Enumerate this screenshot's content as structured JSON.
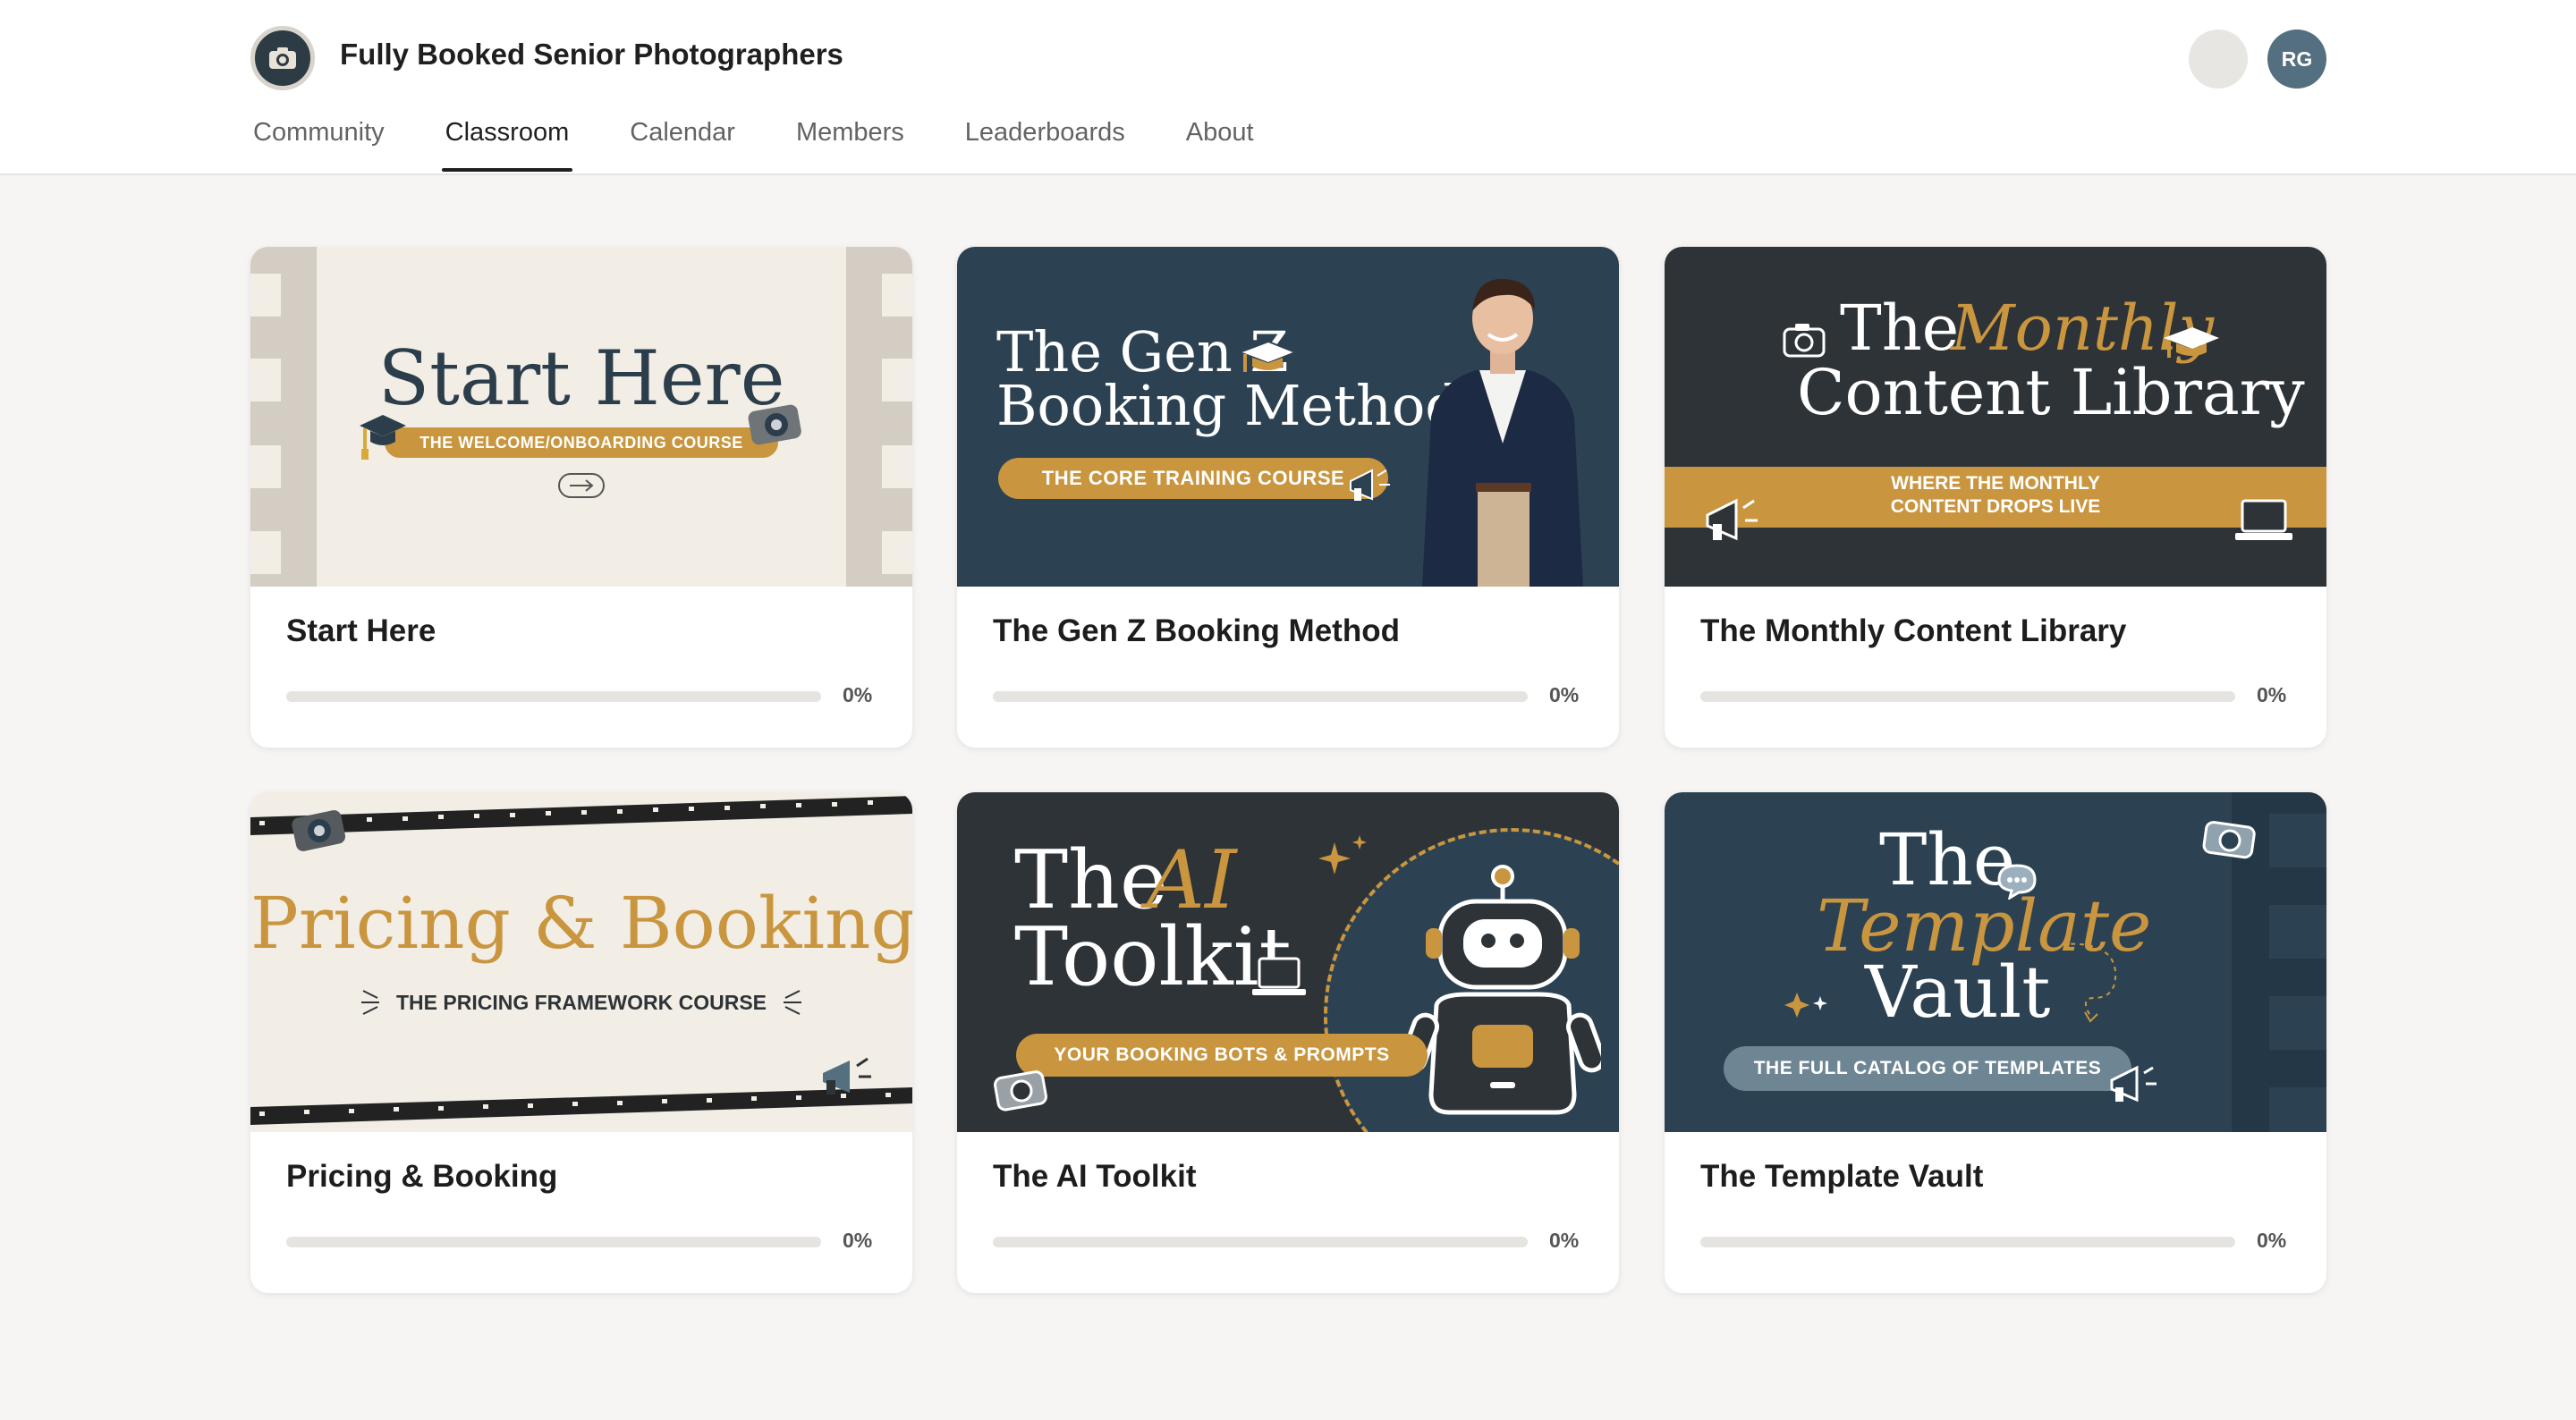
{
  "header": {
    "group_name": "Fully Booked Senior Photographers",
    "avatar_initials": "RG"
  },
  "nav": {
    "items": [
      {
        "label": "Community",
        "active": false
      },
      {
        "label": "Classroom",
        "active": true
      },
      {
        "label": "Calendar",
        "active": false
      },
      {
        "label": "Members",
        "active": false
      },
      {
        "label": "Leaderboards",
        "active": false
      },
      {
        "label": "About",
        "active": false
      }
    ]
  },
  "courses": [
    {
      "title": "Start Here",
      "progress_label": "0%",
      "progress": 0,
      "banner": {
        "heading": "Start Here",
        "tagline": "THE WELCOME/ONBOARDING COURSE"
      }
    },
    {
      "title": "The Gen Z Booking Method",
      "progress_label": "0%",
      "progress": 0,
      "banner": {
        "heading_line1": "The Gen Z",
        "heading_line2": "Booking Method",
        "tagline": "THE CORE TRAINING COURSE"
      }
    },
    {
      "title": "The Monthly Content Library",
      "progress_label": "0%",
      "progress": 0,
      "banner": {
        "heading_the": "The",
        "heading_accent": "Monthly",
        "heading_line2": "Content Library",
        "tagline_line1": "WHERE THE MONTHLY",
        "tagline_line2": "CONTENT DROPS LIVE"
      }
    },
    {
      "title": "Pricing & Booking",
      "progress_label": "0%",
      "progress": 0,
      "banner": {
        "heading": "Pricing & Booking",
        "tagline": "THE PRICING FRAMEWORK COURSE"
      }
    },
    {
      "title": "The AI Toolkit",
      "progress_label": "0%",
      "progress": 0,
      "banner": {
        "heading_the": "The",
        "heading_accent": "AI",
        "heading_line2": "Toolkit",
        "tagline": "YOUR BOOKING BOTS & PROMPTS"
      }
    },
    {
      "title": "The Template Vault",
      "progress_label": "0%",
      "progress": 0,
      "banner": {
        "heading_the": "The",
        "heading_accent": "Template",
        "heading_line3": "Vault",
        "tagline": "THE FULL CATALOG OF TEMPLATES"
      }
    }
  ],
  "colors": {
    "navy": "#2c4252",
    "charcoal": "#2e3338",
    "gold": "#c9963f",
    "cream": "#f2eee6",
    "slate": "#546f7f"
  }
}
